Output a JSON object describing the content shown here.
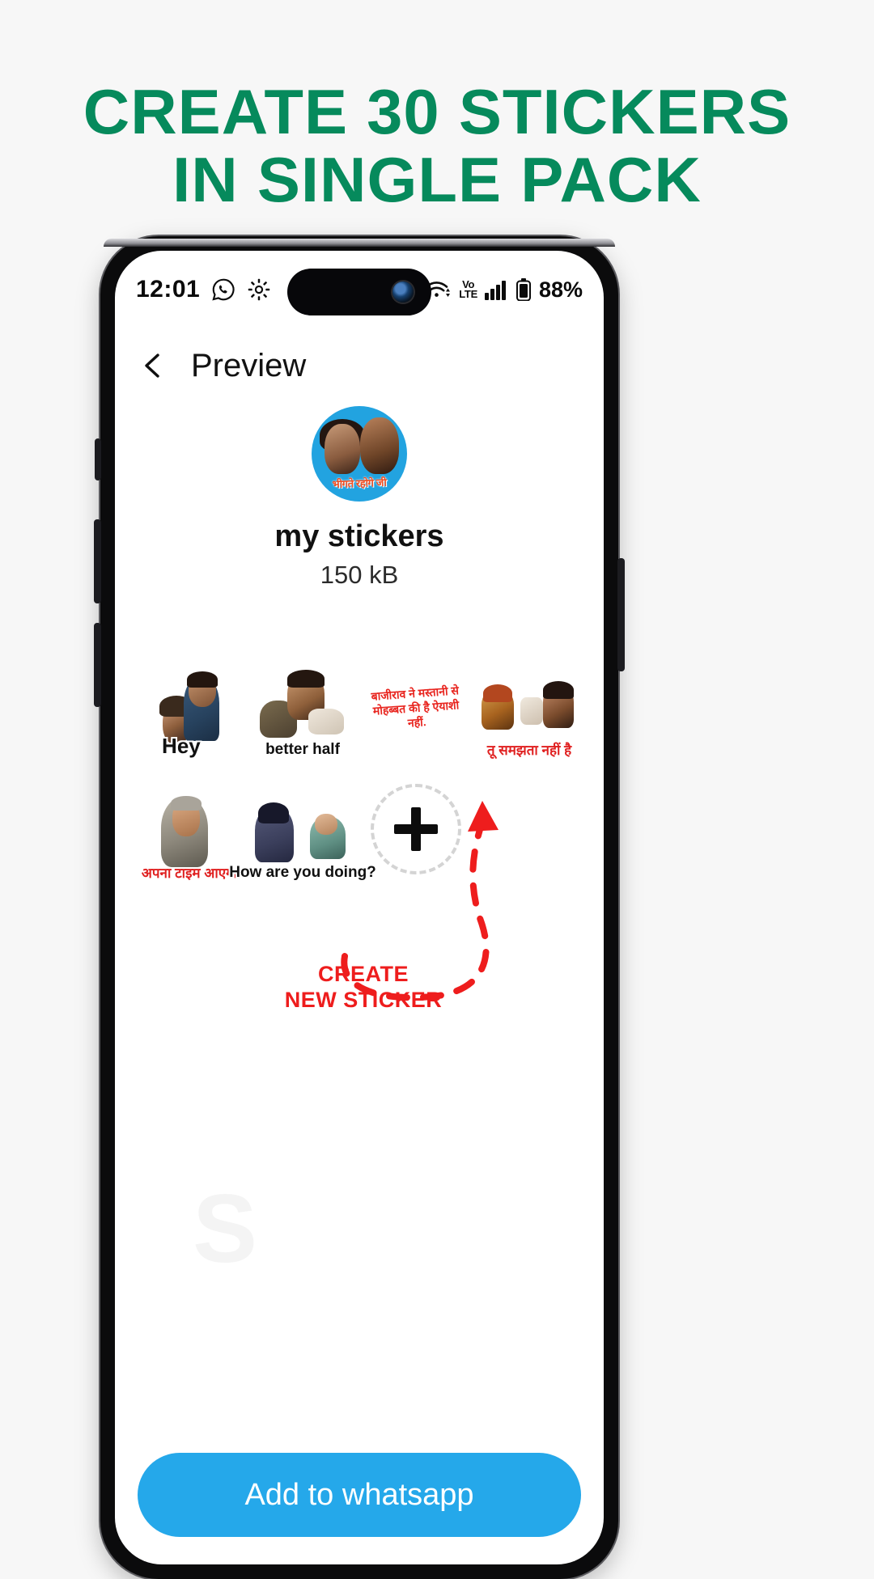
{
  "promo": {
    "line1": "CREATE 30 STICKERS",
    "line2": "IN SINGLE PACK",
    "color": "#068a5c"
  },
  "phone": {
    "statusbar": {
      "time": "12:01",
      "icons_left": [
        "whatsapp-icon",
        "settings-gear-icon"
      ],
      "wifi_icon": "wifi-icon",
      "volte_top": "Vo",
      "volte_bottom": "LTE",
      "signal_icon": "signal-bars-icon",
      "battery_icon": "battery-icon",
      "battery_percent": "88%"
    },
    "appbar": {
      "back_icon": "back-chevron-icon",
      "title": "Preview"
    },
    "pack": {
      "avatar_caption": "भीगते रहोगे जी",
      "avatar_bg": "#22a3e0",
      "name": "my stickers",
      "size": "150 kB"
    },
    "stickers": [
      {
        "caption": "Hey",
        "style": "outline"
      },
      {
        "caption": "better half",
        "style": "outline-small"
      },
      {
        "caption": "बाजीराव ने मस्तानी से\nमोहब्बत की है ऐयाशी नहीं.",
        "style": "hindi-red-block"
      },
      {
        "caption": "तू समझता नहीं है",
        "style": "red"
      },
      {
        "caption": "अपना टाइम आएगा",
        "style": "red"
      },
      {
        "caption": "How are you doing?",
        "style": "outline-small"
      }
    ],
    "add_button": {
      "icon": "plus-icon",
      "label": ""
    },
    "annotation": {
      "line1": "CREATE",
      "line2": "NEW STICKER",
      "color": "#ee1d1d",
      "arrow_icon": "dashed-curved-arrow-icon"
    },
    "cta": {
      "label": "Add to whatsapp",
      "color": "#25a8ea"
    }
  }
}
